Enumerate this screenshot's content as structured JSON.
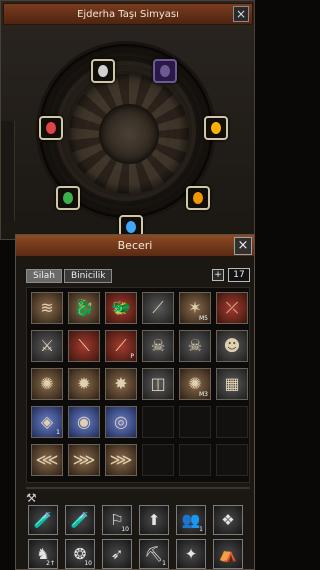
{
  "top_window": {
    "title": "Ejderha Taşı Simyası",
    "close_label": "×"
  },
  "gems": [
    {
      "name": "gem-top",
      "color": "#d0d0d0"
    },
    {
      "name": "gem-top-right-empty",
      "color": "#6e5a92"
    },
    {
      "name": "gem-left",
      "color": "#e04444"
    },
    {
      "name": "gem-right",
      "color": "#ffb000"
    },
    {
      "name": "gem-bottom-left",
      "color": "#39b34a"
    },
    {
      "name": "gem-bottom-right",
      "color": "#f29900"
    },
    {
      "name": "gem-bottom",
      "color": "#3fa8ff"
    }
  ],
  "panel": {
    "title": "Beceri",
    "close_label": "×",
    "tabs": [
      {
        "label": "Silah",
        "active": true
      },
      {
        "label": "Binicilik",
        "active": false
      }
    ],
    "page_plus": "+",
    "page_number": "17"
  },
  "skills": [
    {
      "icon": "≋"
    },
    {
      "icon": "🐉"
    },
    {
      "icon": "🐲"
    },
    {
      "icon": "⟋"
    },
    {
      "icon": "✶",
      "label": "M5"
    },
    {
      "icon": "⤫"
    },
    {
      "icon": "⚔"
    },
    {
      "icon": "⟍"
    },
    {
      "icon": "⟋",
      "label": "P"
    },
    {
      "icon": "☠"
    },
    {
      "icon": "☠"
    },
    {
      "icon": "☻"
    },
    {
      "icon": "✺"
    },
    {
      "icon": "✹"
    },
    {
      "icon": "✸"
    },
    {
      "icon": "◫"
    },
    {
      "icon": "✺",
      "label": "M3"
    },
    {
      "icon": "▦"
    },
    {
      "icon": "◈",
      "label": "1"
    },
    {
      "icon": "◉"
    },
    {
      "icon": "◎"
    },
    {
      "icon": ""
    },
    {
      "icon": ""
    },
    {
      "icon": ""
    },
    {
      "icon": "⋘"
    },
    {
      "icon": "⋙"
    },
    {
      "icon": "⋙"
    },
    {
      "icon": ""
    },
    {
      "icon": ""
    },
    {
      "icon": ""
    }
  ],
  "quick": [
    {
      "icon": "🧪"
    },
    {
      "icon": "🧪"
    },
    {
      "icon": "⚐",
      "label": "10"
    },
    {
      "icon": "⬆"
    },
    {
      "icon": "👥",
      "label": "1"
    },
    {
      "icon": "❖"
    },
    {
      "icon": "♞",
      "label": "2↑"
    },
    {
      "icon": "❂",
      "label": "10"
    },
    {
      "icon": "➶"
    },
    {
      "icon": "⛏",
      "label": "1"
    },
    {
      "icon": "✦"
    },
    {
      "icon": "⛺"
    }
  ]
}
